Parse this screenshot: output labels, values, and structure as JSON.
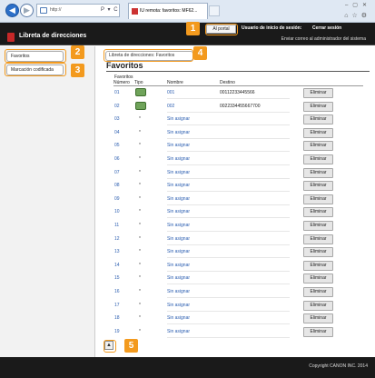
{
  "browser": {
    "url": "http://",
    "tab_title": "IU remota: favoritos: MF62...",
    "addr_tools": "P ▾ C"
  },
  "header": {
    "title": "Libreta de direcciones",
    "portal_button": "Al portal",
    "login_label": "Usuario de inicio de sesión:",
    "logout": "Cerrar sesión",
    "admin_link": "Enviar correo al administrador del sistema"
  },
  "sidebar": {
    "items": [
      {
        "label": "Favoritos"
      },
      {
        "label": "Marcación codificada"
      }
    ]
  },
  "main": {
    "breadcrumb": "Libreta de direcciones: Favoritos",
    "title": "Favoritos",
    "section": "Favoritos",
    "columns": {
      "number": "Número",
      "type": "Tipo",
      "name": "Nombre",
      "destination": "Destino"
    },
    "delete_label": "Eliminar",
    "rows": [
      {
        "number": "01",
        "type": "",
        "name": "001",
        "destination": "00112233445566",
        "has_icon": true
      },
      {
        "number": "02",
        "type": "",
        "name": "002",
        "destination": "0022334455667700",
        "has_icon": true
      },
      {
        "number": "03",
        "type": "*",
        "name": "Sin asignar",
        "destination": ""
      },
      {
        "number": "04",
        "type": "*",
        "name": "Sin asignar",
        "destination": ""
      },
      {
        "number": "05",
        "type": "*",
        "name": "Sin asignar",
        "destination": ""
      },
      {
        "number": "06",
        "type": "*",
        "name": "Sin asignar",
        "destination": ""
      },
      {
        "number": "07",
        "type": "*",
        "name": "Sin asignar",
        "destination": ""
      },
      {
        "number": "08",
        "type": "*",
        "name": "Sin asignar",
        "destination": ""
      },
      {
        "number": "09",
        "type": "*",
        "name": "Sin asignar",
        "destination": ""
      },
      {
        "number": "10",
        "type": "*",
        "name": "Sin asignar",
        "destination": ""
      },
      {
        "number": "11",
        "type": "*",
        "name": "Sin asignar",
        "destination": ""
      },
      {
        "number": "12",
        "type": "*",
        "name": "Sin asignar",
        "destination": ""
      },
      {
        "number": "13",
        "type": "*",
        "name": "Sin asignar",
        "destination": ""
      },
      {
        "number": "14",
        "type": "*",
        "name": "Sin asignar",
        "destination": ""
      },
      {
        "number": "15",
        "type": "*",
        "name": "Sin asignar",
        "destination": ""
      },
      {
        "number": "16",
        "type": "*",
        "name": "Sin asignar",
        "destination": ""
      },
      {
        "number": "17",
        "type": "*",
        "name": "Sin asignar",
        "destination": ""
      },
      {
        "number": "18",
        "type": "*",
        "name": "Sin asignar",
        "destination": ""
      },
      {
        "number": "19",
        "type": "*",
        "name": "Sin asignar",
        "destination": ""
      }
    ]
  },
  "footer": {
    "copyright": "Copyright CANON INC. 2014"
  },
  "callouts": [
    "1",
    "2",
    "3",
    "4",
    "5"
  ],
  "colors": {
    "header_bg": "#1a1a1a",
    "callout": "#f39a1e",
    "link": "#2a5db0"
  }
}
